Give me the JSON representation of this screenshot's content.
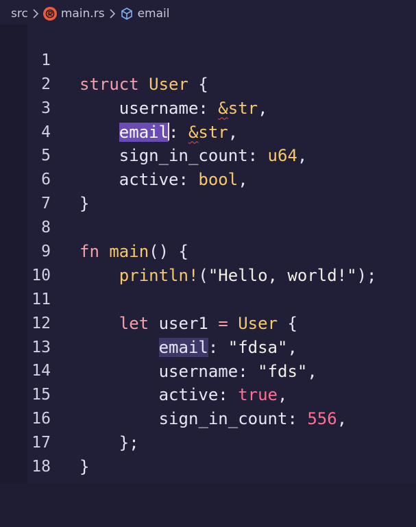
{
  "breadcrumb": {
    "folder": "src",
    "file": "main.rs",
    "symbol": "email"
  },
  "icons": {
    "file_icon": "rust-file-icon",
    "symbol_icon": "struct-field-icon",
    "separator": "chevron-right-icon"
  },
  "colors": {
    "background": "#211f37",
    "keyword": "#f5a0a8",
    "type": "#f7c96b",
    "number": "#ff6f8e",
    "selection": "#6a4bb3"
  },
  "lines": [
    {
      "n": "1",
      "tokens": {
        "a": "struct",
        "b": "User",
        "c": "{"
      }
    },
    {
      "n": "2",
      "tokens": {
        "a": "username",
        "b": ":",
        "c": "&",
        "d": "str",
        "e": ","
      }
    },
    {
      "n": "3",
      "tokens": {
        "a": "email",
        "b": ":",
        "c": "&",
        "d": "str",
        "e": ","
      }
    },
    {
      "n": "4",
      "tokens": {
        "a": "sign_in_count",
        "b": ":",
        "c": "u64",
        "d": ","
      }
    },
    {
      "n": "5",
      "tokens": {
        "a": "active",
        "b": ":",
        "c": "bool",
        "d": ","
      }
    },
    {
      "n": "6",
      "tokens": {
        "a": "}"
      }
    },
    {
      "n": "7",
      "tokens": {}
    },
    {
      "n": "8",
      "tokens": {
        "a": "fn",
        "b": "main",
        "c": "() {"
      }
    },
    {
      "n": "9",
      "tokens": {
        "a": "println!",
        "b": "(",
        "c": "\"Hello, world!\"",
        "d": ");"
      }
    },
    {
      "n": "10",
      "tokens": {}
    },
    {
      "n": "11",
      "tokens": {
        "a": "let",
        "b": "user1",
        "c": "=",
        "d": "User",
        "e": "{"
      }
    },
    {
      "n": "12",
      "tokens": {
        "a": "email",
        "b": ":",
        "c": "\"fdsa\"",
        "d": ","
      }
    },
    {
      "n": "13",
      "tokens": {
        "a": "username",
        "b": ":",
        "c": "\"fds\"",
        "d": ","
      }
    },
    {
      "n": "14",
      "tokens": {
        "a": "active",
        "b": ":",
        "c": "true",
        "d": ","
      }
    },
    {
      "n": "15",
      "tokens": {
        "a": "sign_in_count",
        "b": ":",
        "c": "556",
        "d": ","
      }
    },
    {
      "n": "16",
      "tokens": {
        "a": "};"
      }
    },
    {
      "n": "17",
      "tokens": {
        "a": "}"
      }
    },
    {
      "n": "18",
      "tokens": {}
    }
  ]
}
